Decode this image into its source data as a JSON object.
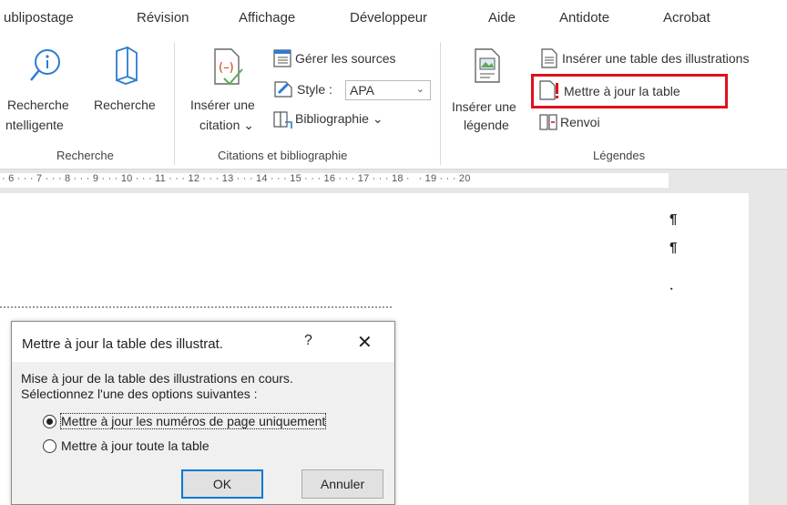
{
  "tabs": [
    "ublipostage",
    "Révision",
    "Affichage",
    "Développeur",
    "Aide",
    "Antidote",
    "Acrobat"
  ],
  "ribbon": {
    "recherche": {
      "btn1_line1": "Recherche",
      "btn1_line2": "ntelligente",
      "btn2_line1": "Recherche",
      "group_label": "Recherche"
    },
    "citations": {
      "insert_line1": "Insérer une",
      "insert_line2": "citation ⌄",
      "manage_sources": "Gérer les sources",
      "style_label": "Style :",
      "style_value": "APA",
      "bibliography": "Bibliographie ⌄",
      "group_label": "Citations et bibliographie"
    },
    "legendes": {
      "insert_line1": "Insérer une",
      "insert_line2": "légende",
      "insert_table": "Insérer une table des illustrations",
      "update_table": "Mettre à jour la table",
      "cross_ref": "Renvoi",
      "group_label": "Légendes"
    },
    "highlight_color": "#e0101c"
  },
  "ruler": {
    "text": "· 6 · · · 7 · · · 8 · · · 9 · · · 10 · · · 11 · · · 12 · · · 13 · · · 14 · · · 15 · · · 16 · · · 17 · · · 18 ·   · 19 · · · 20"
  },
  "document": {
    "pilcrow": "¶"
  },
  "dialog": {
    "title": "Mettre à jour la table des illustrat.",
    "help": "?",
    "close": "✕",
    "message_line1": "Mise à jour de la table des illustrations en cours.",
    "message_line2": "Sélectionnez l'une des options suivantes :",
    "options": [
      {
        "label": "Mettre à jour les numéros de page uniquement",
        "checked": true
      },
      {
        "label": "Mettre à jour toute la table",
        "checked": false
      }
    ],
    "ok": "OK",
    "cancel": "Annuler"
  }
}
